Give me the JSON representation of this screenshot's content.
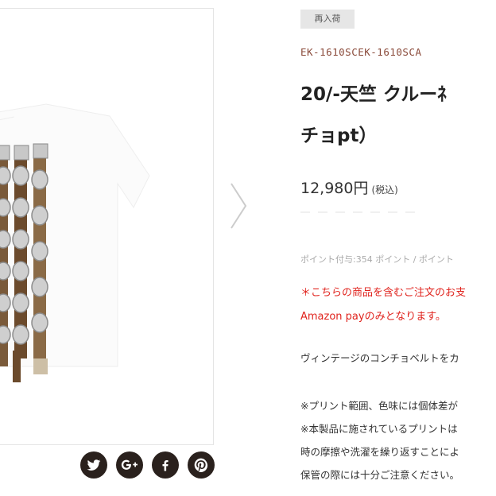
{
  "product": {
    "badge": "再入荷",
    "sku": "EK-1610SCEK-1610SCA",
    "title_line1": "20/-天竺 クルーﾈ",
    "title_line2": "チョpt）",
    "price": "12,980円",
    "tax_label": "(税込)",
    "points": "ポイント付与:354 ポイント / ポイント",
    "notice_line1": "＊こちらの商品を含むご注文のお支",
    "notice_line2": "Amazon payのみとなります。",
    "description": "ヴィンテージのコンチョベルトをカ",
    "note_line1": "※プリント範囲、色味には個体差が",
    "note_line2": "※本製品に施されているプリントは",
    "note_line3": "時の摩擦や洗濯を繰り返すことによ",
    "note_line4": "保管の際には十分ご注意ください。"
  },
  "social": [
    "twitter-icon",
    "google-plus-icon",
    "facebook-icon",
    "pinterest-icon"
  ],
  "colors": {
    "sku": "#8a4a3a",
    "notice": "#e0231d",
    "social_bg": "#2a211d",
    "badge_bg": "#e6e6e6"
  }
}
